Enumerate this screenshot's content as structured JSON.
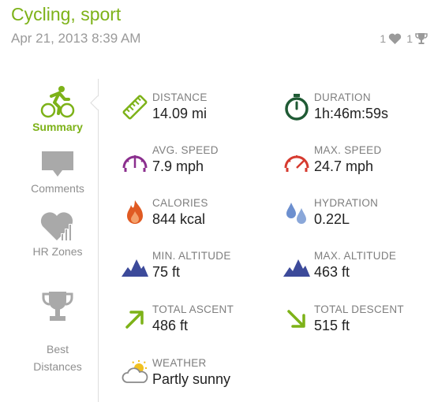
{
  "header": {
    "title": "Cycling, sport",
    "date": "Apr 21, 2013 8:39 AM",
    "likes_count": "1",
    "trophies_count": "1"
  },
  "nav": {
    "items": [
      {
        "label": "Summary",
        "icon": "cyclist-icon",
        "active": true
      },
      {
        "label": "Comments",
        "icon": "speech-bubble-icon",
        "active": false
      },
      {
        "label": "HR Zones",
        "icon": "heart-chart-icon",
        "active": false
      },
      {
        "label": "Best\nDistances",
        "icon": "trophy-icon",
        "active": false
      }
    ]
  },
  "stats": {
    "distance": {
      "label": "DISTANCE",
      "value": "14.09 mi",
      "icon": "ruler-icon"
    },
    "duration": {
      "label": "DURATION",
      "value": "1h:46m:59s",
      "icon": "stopwatch-icon"
    },
    "avg_speed": {
      "label": "AVG. SPEED",
      "value": "7.9 mph",
      "icon": "speedometer-icon"
    },
    "max_speed": {
      "label": "MAX. SPEED",
      "value": "24.7 mph",
      "icon": "speedometer-icon"
    },
    "calories": {
      "label": "CALORIES",
      "value": "844 kcal",
      "icon": "flame-icon"
    },
    "hydration": {
      "label": "HYDRATION",
      "value": "0.22L",
      "icon": "water-drops-icon"
    },
    "min_altitude": {
      "label": "MIN. ALTITUDE",
      "value": "75 ft",
      "icon": "mountains-icon"
    },
    "max_altitude": {
      "label": "MAX. ALTITUDE",
      "value": "463 ft",
      "icon": "mountains-icon"
    },
    "total_ascent": {
      "label": "TOTAL ASCENT",
      "value": "486 ft",
      "icon": "arrow-up-right-icon"
    },
    "total_descent": {
      "label": "TOTAL DESCENT",
      "value": "515 ft",
      "icon": "arrow-down-right-icon"
    },
    "weather": {
      "label": "WEATHER",
      "value": "Partly sunny",
      "icon": "partly-sunny-icon"
    }
  },
  "colors": {
    "accent": "#7db218",
    "muted": "#9a9a9a",
    "avg_speed": "#8b2f8e",
    "max_speed": "#d63a2f",
    "flame": "#e05a22",
    "water": "#6c8fcf",
    "mountains": "#3c4a9a",
    "duration": "#1f5a34"
  }
}
